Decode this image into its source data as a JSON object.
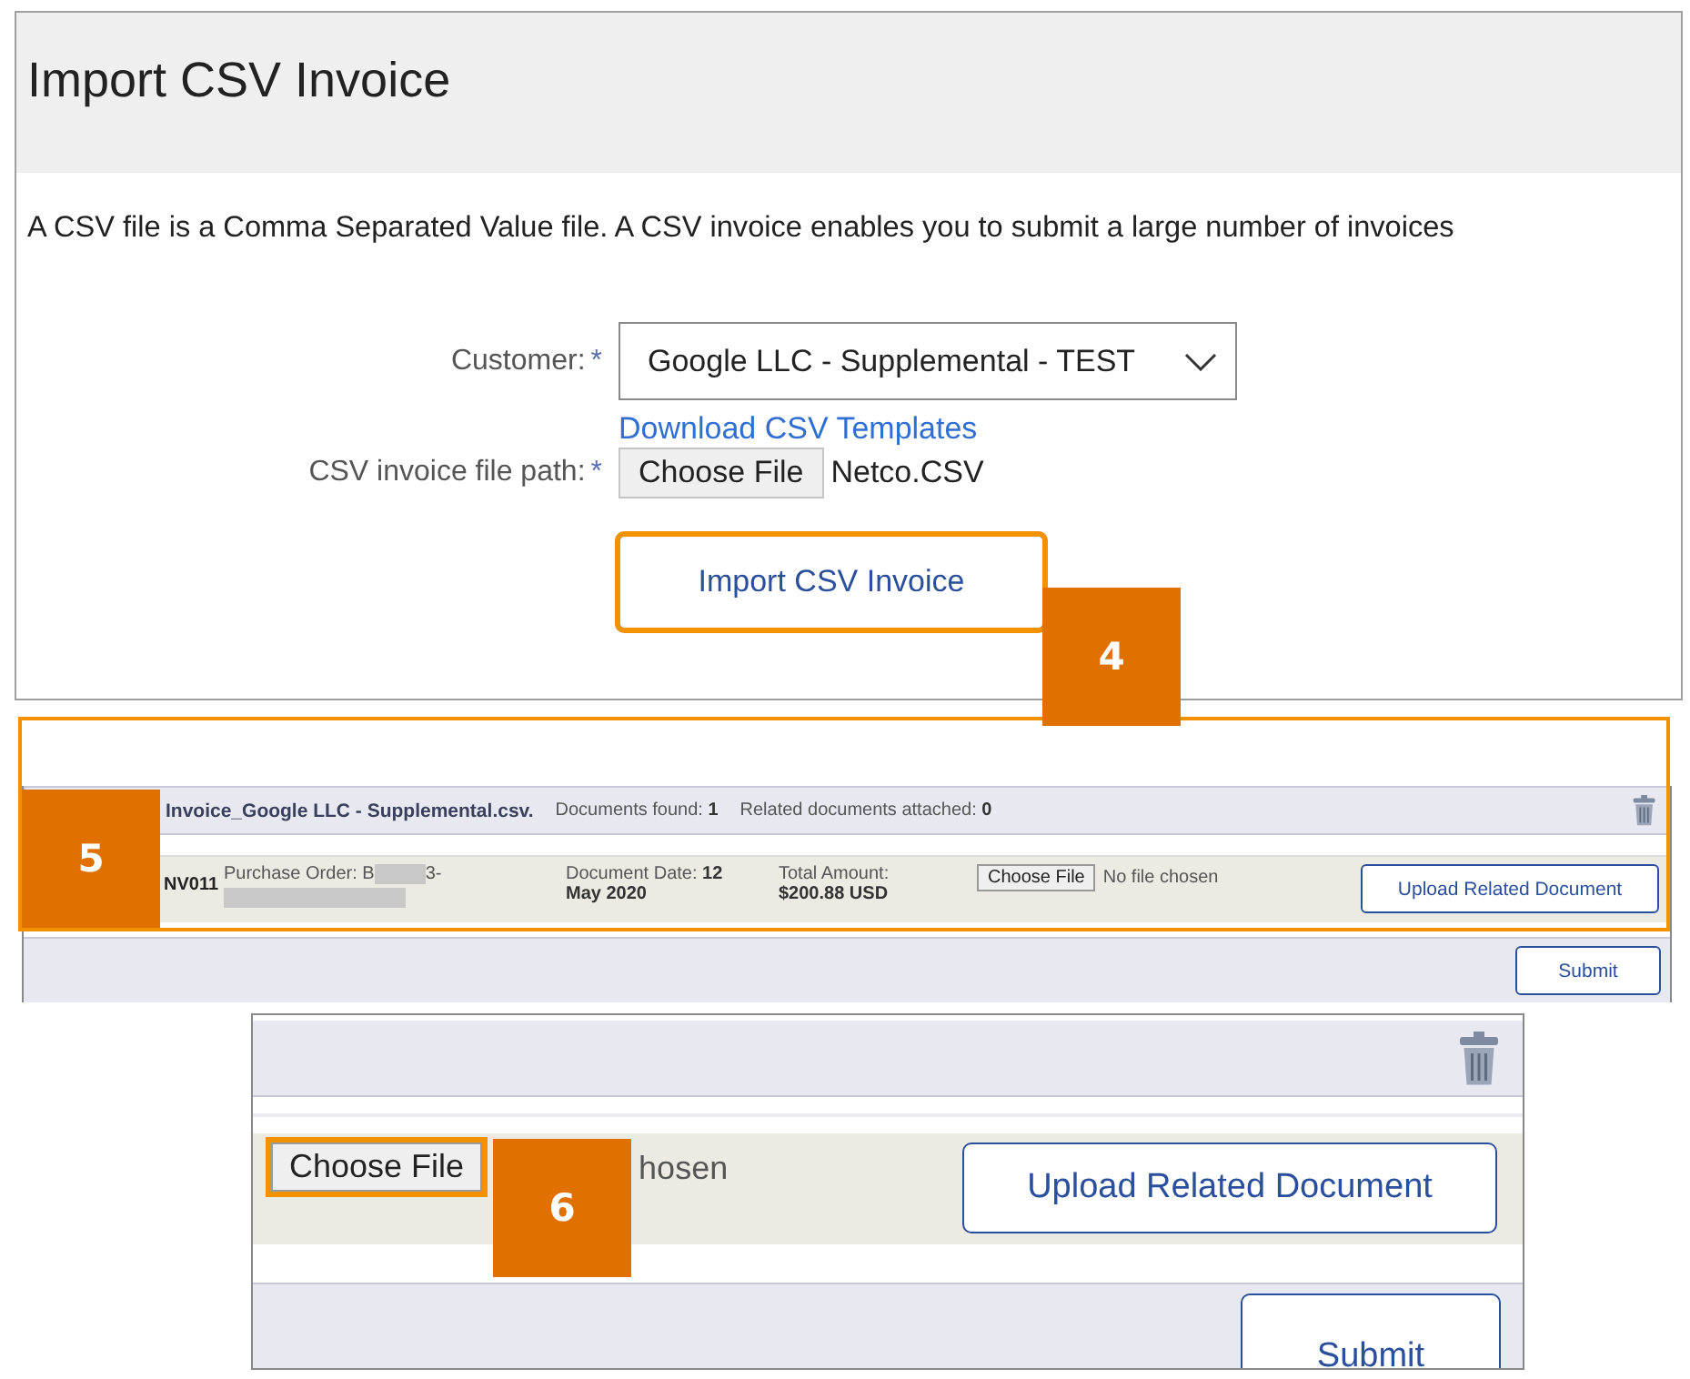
{
  "import_panel": {
    "title": "Import CSV Invoice",
    "description": "A CSV file is a Comma Separated Value file. A CSV invoice enables you to submit a large number of invoices",
    "customer": {
      "label": "Customer:",
      "required_mark": "*",
      "value": "Google LLC - Supplemental - TEST"
    },
    "templates_link": "Download CSV Templates",
    "file_path": {
      "label": "CSV invoice file path:",
      "required_mark": "*",
      "button": "Choose File",
      "file_name": "Netco.CSV"
    },
    "import_button": {
      "label": "Import CSV Invoice",
      "highlighted": true
    }
  },
  "result_panel": {
    "file_name": "Invoice_Google LLC - Supplemental.csv.",
    "documents_found": "Documents found: **1**",
    "related_attached": "Related documents attached: **0**",
    "invoice": {
      "number": "NV011",
      "purchase_order_start": "Purchase Order: B",
      "purchase_order_end": "3-",
      "document_date": "Document Date: **12 May 2020**",
      "total_label": "Total Amount:",
      "total_value": "$200.88 USD",
      "choose_button": "Choose File",
      "file_status": "No file chosen",
      "upload_button": "Upload Related Document"
    },
    "submit_button": "Submit"
  },
  "zoom_panel": {
    "choose_button": {
      "label": "Choose File",
      "highlighted": true
    },
    "file_status": "hosen",
    "upload_button": "Upload Related Document",
    "submit_button": "Submit"
  },
  "steps": [
    {
      "number": "4"
    },
    {
      "number": "5"
    },
    {
      "number": "6"
    }
  ]
}
